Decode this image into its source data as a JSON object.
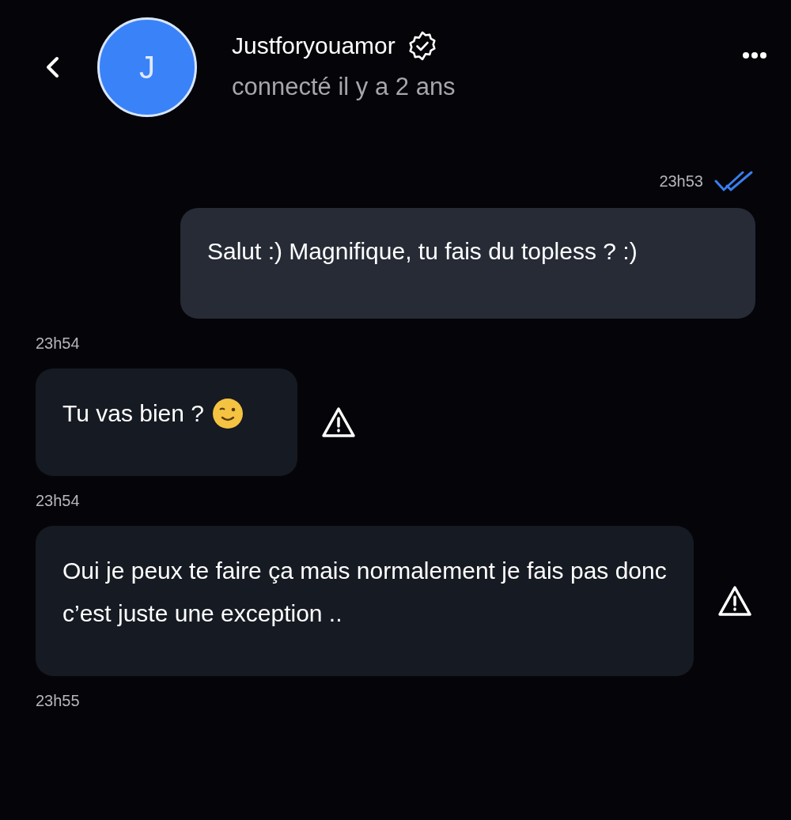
{
  "header": {
    "avatar_letter": "J",
    "name": "Justforyouamor",
    "verified": true,
    "status": "connecté il y a 2 ans"
  },
  "items": [
    {
      "kind": "sent_time",
      "text": "23h53",
      "read": true
    },
    {
      "kind": "sent",
      "text": "Salut :) Magnifique, tu fais du topless ? :)"
    },
    {
      "kind": "received_time",
      "text": "23h54"
    },
    {
      "kind": "received",
      "text": "Tu vas bien ?",
      "wink_emoji": true
    },
    {
      "kind": "received_time",
      "text": "23h54"
    },
    {
      "kind": "received",
      "text": "Oui je peux te faire ça mais normalement je fais pas donc c’est juste une exception ..",
      "wink_emoji": false
    },
    {
      "kind": "received_time",
      "text": "23h55"
    }
  ]
}
